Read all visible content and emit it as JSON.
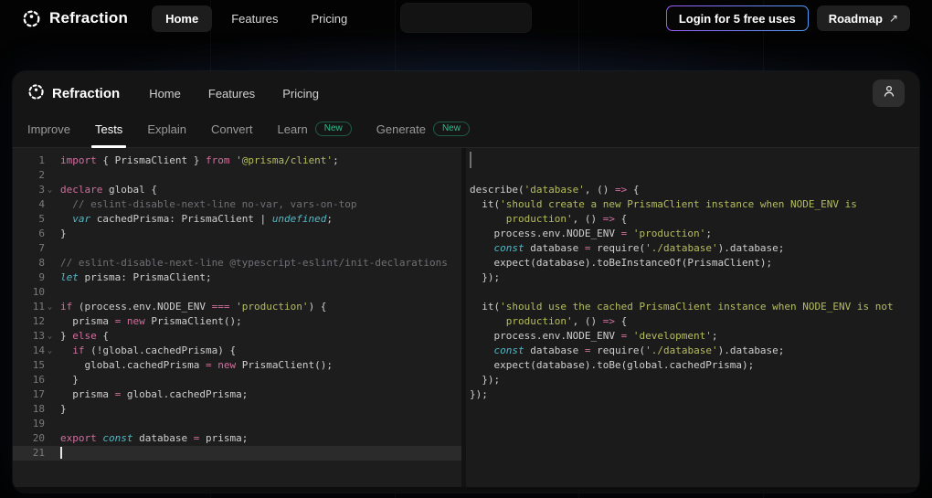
{
  "topbar": {
    "brand": "Refraction",
    "nav": [
      {
        "label": "Home",
        "active": true
      },
      {
        "label": "Features",
        "active": false
      },
      {
        "label": "Pricing",
        "active": false
      }
    ],
    "login_button": "Login for 5 free uses",
    "roadmap_button": "Roadmap",
    "roadmap_arrow": "↗"
  },
  "window": {
    "brand": "Refraction",
    "nav": [
      "Home",
      "Features",
      "Pricing"
    ],
    "tabs": [
      {
        "label": "Improve",
        "active": false,
        "badge": ""
      },
      {
        "label": "Tests",
        "active": true,
        "badge": ""
      },
      {
        "label": "Explain",
        "active": false,
        "badge": ""
      },
      {
        "label": "Convert",
        "active": false,
        "badge": ""
      },
      {
        "label": "Learn",
        "active": false,
        "badge": "New"
      },
      {
        "label": "Generate",
        "active": false,
        "badge": "New"
      }
    ],
    "editor": {
      "left_lines": [
        {
          "n": 1,
          "tokens": [
            [
              "import",
              "k"
            ],
            [
              " { PrismaClient } ",
              "p"
            ],
            [
              "from",
              "k"
            ],
            [
              " ",
              "p"
            ],
            [
              "'@prisma/client'",
              "s"
            ],
            [
              ";",
              "p"
            ]
          ]
        },
        {
          "n": 2,
          "tokens": []
        },
        {
          "n": 3,
          "fold": true,
          "tokens": [
            [
              "declare",
              "k"
            ],
            [
              " global {",
              "p"
            ]
          ]
        },
        {
          "n": 4,
          "tokens": [
            [
              "  // eslint-disable-next-line no-var, vars-on-top",
              "c"
            ]
          ]
        },
        {
          "n": 5,
          "tokens": [
            [
              "  ",
              "p"
            ],
            [
              "var",
              "d"
            ],
            [
              " cachedPrisma: PrismaClient | ",
              "p"
            ],
            [
              "undefined",
              "d"
            ],
            [
              ";",
              "p"
            ]
          ]
        },
        {
          "n": 6,
          "tokens": [
            [
              "}",
              "p"
            ]
          ]
        },
        {
          "n": 7,
          "tokens": []
        },
        {
          "n": 8,
          "tokens": [
            [
              "// eslint-disable-next-line @typescript-eslint/init-declarations",
              "c"
            ]
          ]
        },
        {
          "n": 9,
          "tokens": [
            [
              "let",
              "d"
            ],
            [
              " prisma: PrismaClient;",
              "p"
            ]
          ]
        },
        {
          "n": 10,
          "tokens": []
        },
        {
          "n": 11,
          "fold": true,
          "tokens": [
            [
              "if",
              "k"
            ],
            [
              " (process.env.NODE_ENV ",
              "p"
            ],
            [
              "===",
              "k"
            ],
            [
              " ",
              "p"
            ],
            [
              "'production'",
              "s"
            ],
            [
              ") {",
              "p"
            ]
          ]
        },
        {
          "n": 12,
          "tokens": [
            [
              "  prisma ",
              "p"
            ],
            [
              "=",
              "k"
            ],
            [
              " ",
              "p"
            ],
            [
              "new",
              "k"
            ],
            [
              " PrismaClient();",
              "p"
            ]
          ]
        },
        {
          "n": 13,
          "fold": true,
          "tokens": [
            [
              "} ",
              "p"
            ],
            [
              "else",
              "k"
            ],
            [
              " {",
              "p"
            ]
          ]
        },
        {
          "n": 14,
          "fold": true,
          "tokens": [
            [
              "  ",
              "p"
            ],
            [
              "if",
              "k"
            ],
            [
              " (!global.cachedPrisma) {",
              "p"
            ]
          ]
        },
        {
          "n": 15,
          "tokens": [
            [
              "    global.cachedPrisma ",
              "p"
            ],
            [
              "=",
              "k"
            ],
            [
              " ",
              "p"
            ],
            [
              "new",
              "k"
            ],
            [
              " PrismaClient();",
              "p"
            ]
          ]
        },
        {
          "n": 16,
          "tokens": [
            [
              "  }",
              "p"
            ]
          ]
        },
        {
          "n": 17,
          "tokens": [
            [
              "  prisma ",
              "p"
            ],
            [
              "=",
              "k"
            ],
            [
              " global.cachedPrisma;",
              "p"
            ]
          ]
        },
        {
          "n": 18,
          "tokens": [
            [
              "}",
              "p"
            ]
          ]
        },
        {
          "n": 19,
          "tokens": []
        },
        {
          "n": 20,
          "tokens": [
            [
              "export",
              "k"
            ],
            [
              " ",
              "p"
            ],
            [
              "const",
              "d"
            ],
            [
              " database ",
              "p"
            ],
            [
              "=",
              "k"
            ],
            [
              " prisma;",
              "p"
            ]
          ]
        },
        {
          "n": 21,
          "hl": true,
          "cursor": true,
          "tokens": []
        }
      ],
      "right_lines": [
        {
          "cursor": true,
          "tokens": []
        },
        {
          "tokens": []
        },
        {
          "tokens": [
            [
              "describe(",
              "p"
            ],
            [
              "'database'",
              "s"
            ],
            [
              ", () ",
              "p"
            ],
            [
              "=>",
              "k"
            ],
            [
              " {",
              "p"
            ]
          ]
        },
        {
          "tokens": [
            [
              "  it(",
              "p"
            ],
            [
              "'should create a new PrismaClient instance when NODE_ENV is",
              "s"
            ]
          ]
        },
        {
          "tokens": [
            [
              "      production'",
              "s"
            ],
            [
              ", () ",
              "p"
            ],
            [
              "=>",
              "k"
            ],
            [
              " {",
              "p"
            ]
          ]
        },
        {
          "tokens": [
            [
              "    process.env.NODE_ENV ",
              "p"
            ],
            [
              "=",
              "k"
            ],
            [
              " ",
              "p"
            ],
            [
              "'production'",
              "s"
            ],
            [
              ";",
              "p"
            ]
          ]
        },
        {
          "tokens": [
            [
              "    ",
              "p"
            ],
            [
              "const",
              "d"
            ],
            [
              " database ",
              "p"
            ],
            [
              "=",
              "k"
            ],
            [
              " require(",
              "p"
            ],
            [
              "'./database'",
              "s"
            ],
            [
              ").database;",
              "p"
            ]
          ]
        },
        {
          "tokens": [
            [
              "    expect(database).toBeInstanceOf(PrismaClient);",
              "p"
            ]
          ]
        },
        {
          "tokens": [
            [
              "  });",
              "p"
            ]
          ]
        },
        {
          "tokens": []
        },
        {
          "tokens": [
            [
              "  it(",
              "p"
            ],
            [
              "'should use the cached PrismaClient instance when NODE_ENV is not",
              "s"
            ]
          ]
        },
        {
          "tokens": [
            [
              "      production'",
              "s"
            ],
            [
              ", () ",
              "p"
            ],
            [
              "=>",
              "k"
            ],
            [
              " {",
              "p"
            ]
          ]
        },
        {
          "tokens": [
            [
              "    process.env.NODE_ENV ",
              "p"
            ],
            [
              "=",
              "k"
            ],
            [
              " ",
              "p"
            ],
            [
              "'development'",
              "s"
            ],
            [
              ";",
              "p"
            ]
          ]
        },
        {
          "tokens": [
            [
              "    ",
              "p"
            ],
            [
              "const",
              "d"
            ],
            [
              " database ",
              "p"
            ],
            [
              "=",
              "k"
            ],
            [
              " require(",
              "p"
            ],
            [
              "'./database'",
              "s"
            ],
            [
              ").database;",
              "p"
            ]
          ]
        },
        {
          "tokens": [
            [
              "    expect(database).toBe(global.cachedPrisma);",
              "p"
            ]
          ]
        },
        {
          "tokens": [
            [
              "  });",
              "p"
            ]
          ]
        },
        {
          "tokens": [
            [
              "});",
              "p"
            ]
          ]
        }
      ]
    }
  },
  "colors": {
    "keyword": "#d16d9d",
    "declaration": "#56b6c2",
    "string": "#b5bd5e",
    "comment": "#6e7075",
    "plain": "#cfcfcf",
    "badge_green": "#2fbf8f",
    "login_gradient_start": "#9b5cf6",
    "login_gradient_end": "#4d9df6"
  }
}
